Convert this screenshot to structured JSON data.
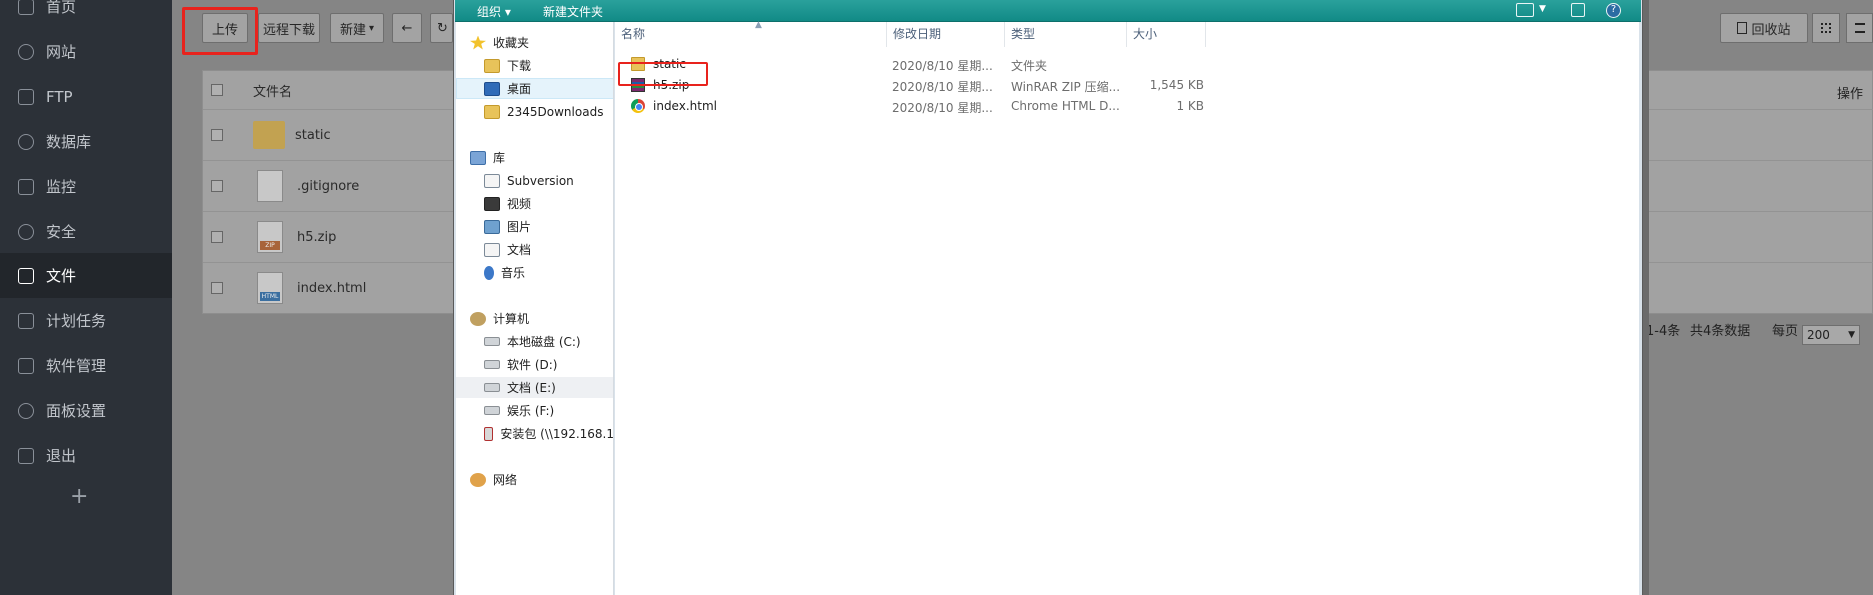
{
  "sidebar": {
    "items": [
      {
        "label": "首页",
        "icon": "home-icon"
      },
      {
        "label": "网站",
        "icon": "globe-icon"
      },
      {
        "label": "FTP",
        "icon": "ftp-icon"
      },
      {
        "label": "数据库",
        "icon": "database-icon"
      },
      {
        "label": "监控",
        "icon": "monitor-icon"
      },
      {
        "label": "安全",
        "icon": "shield-icon"
      },
      {
        "label": "文件",
        "icon": "folder-icon",
        "active": true
      },
      {
        "label": "计划任务",
        "icon": "calendar-icon"
      },
      {
        "label": "软件管理",
        "icon": "grid-icon"
      },
      {
        "label": "面板设置",
        "icon": "gear-icon"
      },
      {
        "label": "退出",
        "icon": "logout-icon"
      }
    ],
    "add_symbol": "+"
  },
  "filemanager": {
    "toolbar": {
      "upload": "上传",
      "remote_download": "远程下载",
      "new": "新建",
      "new_arrow": "▾",
      "back": "←",
      "refresh": "↻",
      "recycle_bin": "回收站"
    },
    "table": {
      "header_name": "文件名",
      "header_ops": "操作",
      "rows": [
        {
          "name": "static",
          "type": "folder"
        },
        {
          "name": ".gitignore",
          "type": "file"
        },
        {
          "name": "h5.zip",
          "type": "zip",
          "tag": "ZIP"
        },
        {
          "name": "index.html",
          "type": "html",
          "tag": "HTML"
        }
      ]
    },
    "footer": {
      "range": "1-4条",
      "total": "共4条数据",
      "per_page_label": "每页",
      "per_page_value": "200"
    }
  },
  "dialog": {
    "toolbar": {
      "organize": "组织 ▾",
      "new_folder": "新建文件夹",
      "help": "?"
    },
    "nav": {
      "favorites": "收藏夹",
      "downloads": "下载",
      "desktop": "桌面",
      "downloads_2345": "2345Downloads",
      "libraries": "库",
      "subversion": "Subversion",
      "videos": "视频",
      "pictures": "图片",
      "documents": "文档",
      "music": "音乐",
      "computer": "计算机",
      "drive_c": "本地磁盘 (C:)",
      "drive_d": "软件 (D:)",
      "drive_e": "文档 (E:)",
      "drive_f": "娱乐 (F:)",
      "network_drive": "安装包 (\\\\192.168.1",
      "network": "网络"
    },
    "columns": {
      "name": "名称",
      "date": "修改日期",
      "type": "类型",
      "size": "大小"
    },
    "files": [
      {
        "name": "static",
        "date": "2020/8/10 星期...",
        "type": "文件夹",
        "size": "",
        "icon": "folder"
      },
      {
        "name": "h5.zip",
        "date": "2020/8/10 星期...",
        "type": "WinRAR ZIP 压缩...",
        "size": "1,545 KB",
        "icon": "zip"
      },
      {
        "name": "index.html",
        "date": "2020/8/10 星期...",
        "type": "Chrome HTML D...",
        "size": "1 KB",
        "icon": "chrome"
      }
    ]
  },
  "colors": {
    "sidebar_bg": "#2c3138",
    "dialog_toolbar": "#1a9893",
    "highlight_red": "#e8231d"
  }
}
